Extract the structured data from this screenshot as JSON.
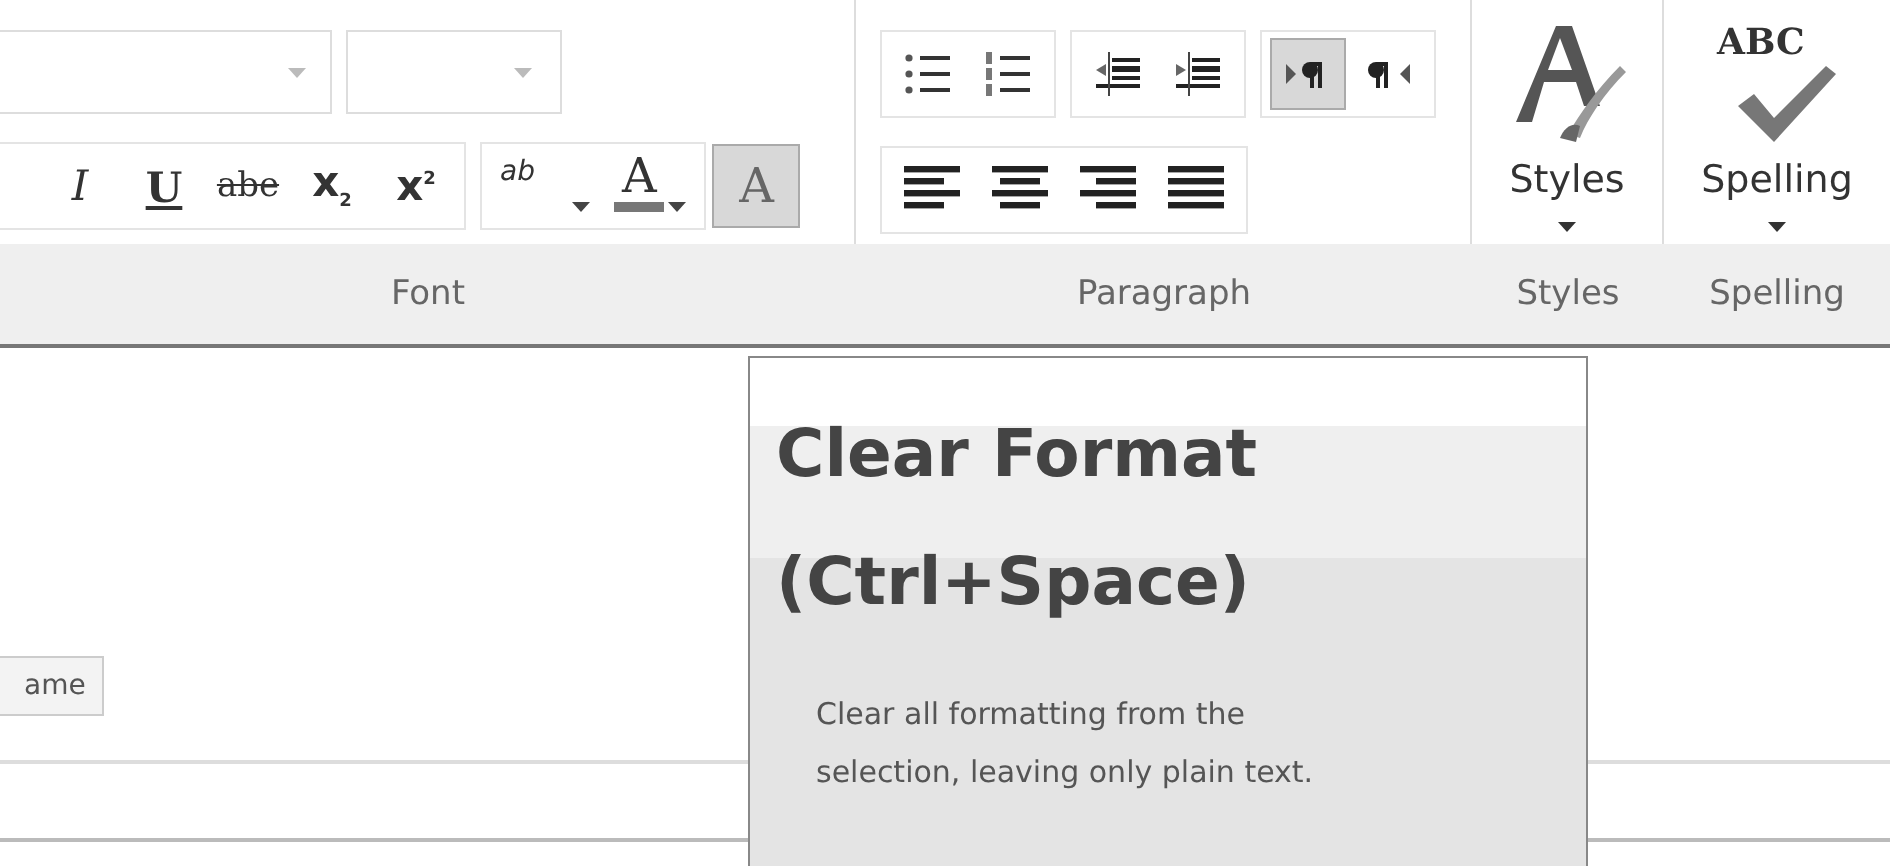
{
  "ribbon": {
    "font_group": {
      "label": "Font",
      "format_buttons": [
        {
          "kind": "italic",
          "glyph": "I",
          "selected": false
        },
        {
          "kind": "underline",
          "glyph": "U",
          "selected": false
        },
        {
          "kind": "strikethrough",
          "glyph": "abe",
          "selected": false
        },
        {
          "kind": "subscript",
          "glyph": "x$_{2}$",
          "selected": false
        },
        {
          "kind": "superscript",
          "glyph": "x$^{2}$",
          "selected": false
        }
      ],
      "color_buttons": [
        {
          "kind": "highlight",
          "glyph": "ab",
          "selected": false
        },
        {
          "kind": "font_color",
          "glyph": "A",
          "selected": false
        }
      ],
      "clear_button": {
        "glyph": "A",
        "selected": true
      }
    },
    "paragraph_group": {
      "label": "Paragraph",
      "list_buttons": [
        {
          "kind": "bullets",
          "selected": false
        },
        {
          "kind": "numbering",
          "selected": false
        }
      ],
      "indent_buttons": [
        {
          "kind": "decrease",
          "selected": false
        },
        {
          "kind": "increase",
          "selected": false
        }
      ],
      "direction_buttons": [
        {
          "kind": "ltr",
          "selected": true
        },
        {
          "kind": "rtl",
          "selected": false
        }
      ],
      "align_buttons": [
        {
          "kind": "left",
          "selected": false
        },
        {
          "kind": "center",
          "selected": false
        },
        {
          "kind": "right",
          "selected": false
        },
        {
          "kind": "justify",
          "selected": false
        }
      ]
    },
    "styles_group": {
      "label": "Styles",
      "button_label": "Styles"
    },
    "spelling_group": {
      "label": "Spelling",
      "button_label": "Spelling",
      "icon_text": "ABC"
    }
  },
  "document": {
    "button_text": "ame"
  },
  "tooltip": {
    "title": "Clear Format (Ctrl+Space)",
    "description": "Clear all formatting from the selection, leaving only plain text."
  }
}
